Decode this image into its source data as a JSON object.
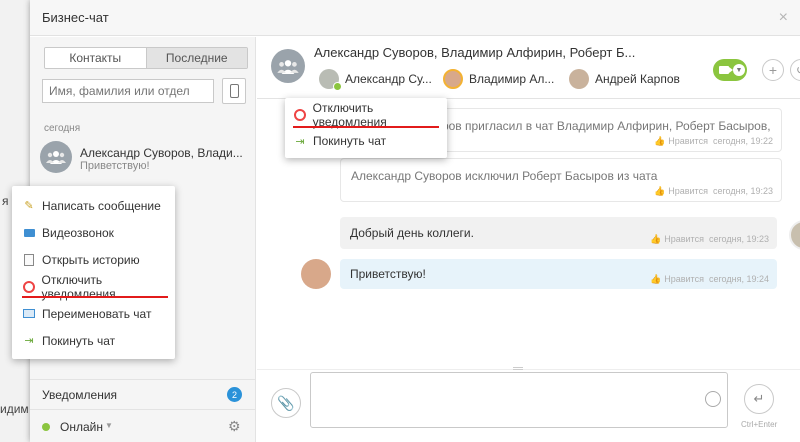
{
  "background": {
    "line1": "я",
    "line2": "идим"
  },
  "window": {
    "title": "Бизнес-чат",
    "close_glyph": "×"
  },
  "sidebar": {
    "tabs": [
      {
        "label": "Контакты"
      },
      {
        "label": "Последние"
      }
    ],
    "search_placeholder": "Имя, фамилия или отдел",
    "section_today": "сегодня",
    "recent": {
      "name": "Александр Суворов, Влади...",
      "message": "Приветствую!"
    },
    "notifications_label": "Уведомления",
    "notifications_count": "2",
    "status_label": "Онлайн",
    "status_color": "#8bc53f"
  },
  "context_menu": {
    "items": [
      {
        "label": "Написать сообщение",
        "icon": "pencil-icon"
      },
      {
        "label": "Видеозвонок",
        "icon": "video-camera-icon"
      },
      {
        "label": "Открыть историю",
        "icon": "history-icon"
      },
      {
        "label": "Отключить уведомления",
        "icon": "mute-notifications-icon"
      },
      {
        "label": "Переименовать чат",
        "icon": "rename-icon"
      },
      {
        "label": "Покинуть чат",
        "icon": "leave-chat-icon"
      }
    ]
  },
  "header_menu": {
    "items": [
      {
        "label": "Отключить уведомления",
        "icon": "mute-notifications-icon"
      },
      {
        "label": "Покинуть чат",
        "icon": "leave-chat-icon"
      }
    ]
  },
  "chat": {
    "title": "Александр Суворов, Владимир Алфирин, Роберт Б...",
    "members": [
      {
        "name": "Александр Су..."
      },
      {
        "name": "Владимир Ал..."
      },
      {
        "name": "Андрей Карпов"
      }
    ],
    "messages": [
      {
        "text": "Александр Суворов пригласил в чат Владимир Алфирин, Роберт Басыров,",
        "like": "Нравится",
        "time": "сегодня, 19:22"
      },
      {
        "text": "Александр Суворов исключил Роберт Басыров из чата",
        "like": "Нравится",
        "time": "сегодня, 19:23"
      },
      {
        "text": "Добрый день коллеги.",
        "like": "Нравится",
        "time": "сегодня, 19:23"
      },
      {
        "text": "Приветствую!",
        "like": "Нравится",
        "time": "сегодня, 19:24"
      }
    ],
    "send_hint": "Ctrl+Enter"
  },
  "colors": {
    "accent_green": "#8bc53f",
    "badge_blue": "#2b92d9",
    "highlight_red": "#e21b1b"
  }
}
